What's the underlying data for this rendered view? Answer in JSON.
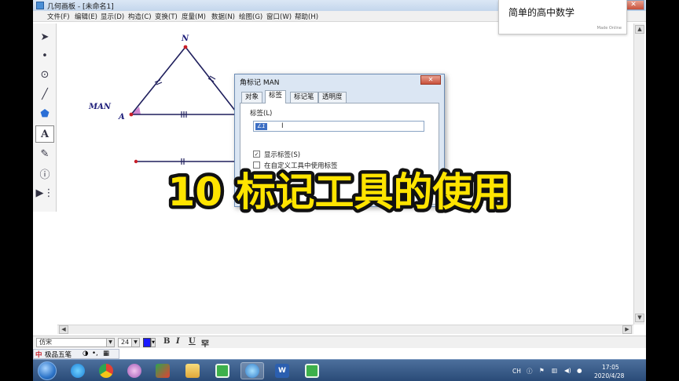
{
  "window": {
    "title": "几何画板 - [未命名1]",
    "minimize": "—",
    "maximize": "□",
    "close": "✕"
  },
  "menu": [
    "文件(F)",
    "编辑(E)",
    "显示(D)",
    "构造(C)",
    "变换(T)",
    "度量(M)",
    "数据(N)",
    "绘图(G)",
    "窗口(W)",
    "帮助(H)"
  ],
  "tools": [
    "selection-arrow-icon",
    "point-icon",
    "compass-icon",
    "straightedge-icon",
    "polygon-icon",
    "text-icon",
    "marker-icon",
    "information-icon",
    "custom-tool-icon"
  ],
  "figure": {
    "angle_label": "MAN",
    "vertex_n": "N",
    "vertex_a": "A",
    "colors": {
      "point": "#c81e28",
      "segment": "#1e1e5c",
      "angle_fill": "#c060c0"
    }
  },
  "dialog": {
    "title": "角标记 MAN",
    "close": "✕",
    "tabs": [
      "对象",
      "标签",
      "标记笔",
      "透明度"
    ],
    "active_tab": "标签",
    "group_label": "标签(L)",
    "label_value": "∠1",
    "show_label": "显示标签(S)",
    "custom_tool_label": "在自定义工具中使用标签"
  },
  "text_toolbar": {
    "font": "仿宋",
    "size": "24",
    "bold": "B",
    "italic": "I",
    "underline": "U",
    "special": "罕"
  },
  "ime": {
    "name": "极品五笔"
  },
  "tray": {
    "lang": "CH",
    "time": "17:05",
    "date": "2020/4/28"
  },
  "watermark": {
    "text": "简单的高中数学",
    "small": "Made Online"
  },
  "banner": {
    "text": "10 标记工具的使用",
    "fill": "#ffe400",
    "stroke": "#111111"
  }
}
